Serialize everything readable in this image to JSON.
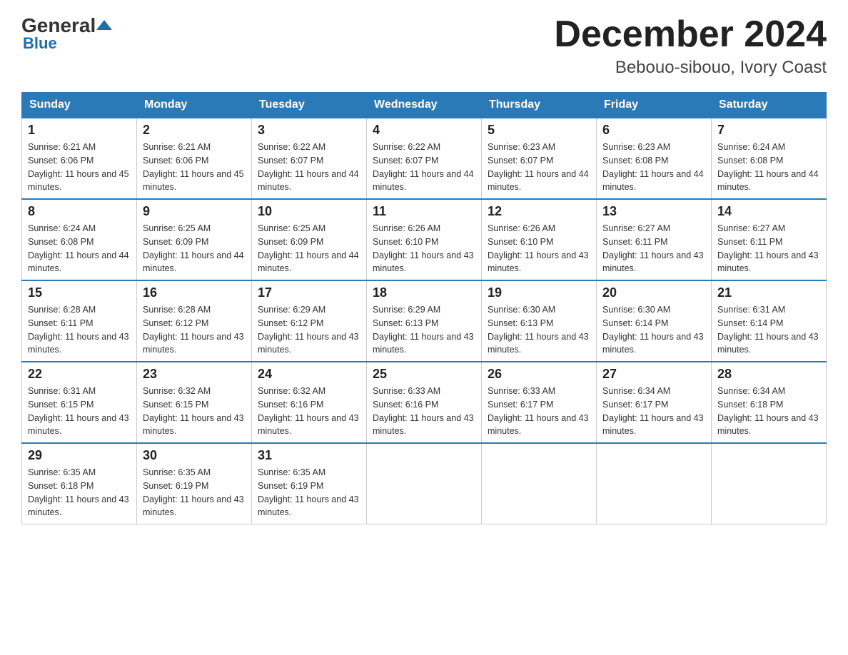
{
  "logo": {
    "name_black": "General",
    "name_blue": "Blue"
  },
  "title": "December 2024",
  "location": "Bebouo-sibouo, Ivory Coast",
  "days_of_week": [
    "Sunday",
    "Monday",
    "Tuesday",
    "Wednesday",
    "Thursday",
    "Friday",
    "Saturday"
  ],
  "weeks": [
    [
      {
        "num": "1",
        "sunrise": "6:21 AM",
        "sunset": "6:06 PM",
        "daylight": "11 hours and 45 minutes."
      },
      {
        "num": "2",
        "sunrise": "6:21 AM",
        "sunset": "6:06 PM",
        "daylight": "11 hours and 45 minutes."
      },
      {
        "num": "3",
        "sunrise": "6:22 AM",
        "sunset": "6:07 PM",
        "daylight": "11 hours and 44 minutes."
      },
      {
        "num": "4",
        "sunrise": "6:22 AM",
        "sunset": "6:07 PM",
        "daylight": "11 hours and 44 minutes."
      },
      {
        "num": "5",
        "sunrise": "6:23 AM",
        "sunset": "6:07 PM",
        "daylight": "11 hours and 44 minutes."
      },
      {
        "num": "6",
        "sunrise": "6:23 AM",
        "sunset": "6:08 PM",
        "daylight": "11 hours and 44 minutes."
      },
      {
        "num": "7",
        "sunrise": "6:24 AM",
        "sunset": "6:08 PM",
        "daylight": "11 hours and 44 minutes."
      }
    ],
    [
      {
        "num": "8",
        "sunrise": "6:24 AM",
        "sunset": "6:08 PM",
        "daylight": "11 hours and 44 minutes."
      },
      {
        "num": "9",
        "sunrise": "6:25 AM",
        "sunset": "6:09 PM",
        "daylight": "11 hours and 44 minutes."
      },
      {
        "num": "10",
        "sunrise": "6:25 AM",
        "sunset": "6:09 PM",
        "daylight": "11 hours and 44 minutes."
      },
      {
        "num": "11",
        "sunrise": "6:26 AM",
        "sunset": "6:10 PM",
        "daylight": "11 hours and 43 minutes."
      },
      {
        "num": "12",
        "sunrise": "6:26 AM",
        "sunset": "6:10 PM",
        "daylight": "11 hours and 43 minutes."
      },
      {
        "num": "13",
        "sunrise": "6:27 AM",
        "sunset": "6:11 PM",
        "daylight": "11 hours and 43 minutes."
      },
      {
        "num": "14",
        "sunrise": "6:27 AM",
        "sunset": "6:11 PM",
        "daylight": "11 hours and 43 minutes."
      }
    ],
    [
      {
        "num": "15",
        "sunrise": "6:28 AM",
        "sunset": "6:11 PM",
        "daylight": "11 hours and 43 minutes."
      },
      {
        "num": "16",
        "sunrise": "6:28 AM",
        "sunset": "6:12 PM",
        "daylight": "11 hours and 43 minutes."
      },
      {
        "num": "17",
        "sunrise": "6:29 AM",
        "sunset": "6:12 PM",
        "daylight": "11 hours and 43 minutes."
      },
      {
        "num": "18",
        "sunrise": "6:29 AM",
        "sunset": "6:13 PM",
        "daylight": "11 hours and 43 minutes."
      },
      {
        "num": "19",
        "sunrise": "6:30 AM",
        "sunset": "6:13 PM",
        "daylight": "11 hours and 43 minutes."
      },
      {
        "num": "20",
        "sunrise": "6:30 AM",
        "sunset": "6:14 PM",
        "daylight": "11 hours and 43 minutes."
      },
      {
        "num": "21",
        "sunrise": "6:31 AM",
        "sunset": "6:14 PM",
        "daylight": "11 hours and 43 minutes."
      }
    ],
    [
      {
        "num": "22",
        "sunrise": "6:31 AM",
        "sunset": "6:15 PM",
        "daylight": "11 hours and 43 minutes."
      },
      {
        "num": "23",
        "sunrise": "6:32 AM",
        "sunset": "6:15 PM",
        "daylight": "11 hours and 43 minutes."
      },
      {
        "num": "24",
        "sunrise": "6:32 AM",
        "sunset": "6:16 PM",
        "daylight": "11 hours and 43 minutes."
      },
      {
        "num": "25",
        "sunrise": "6:33 AM",
        "sunset": "6:16 PM",
        "daylight": "11 hours and 43 minutes."
      },
      {
        "num": "26",
        "sunrise": "6:33 AM",
        "sunset": "6:17 PM",
        "daylight": "11 hours and 43 minutes."
      },
      {
        "num": "27",
        "sunrise": "6:34 AM",
        "sunset": "6:17 PM",
        "daylight": "11 hours and 43 minutes."
      },
      {
        "num": "28",
        "sunrise": "6:34 AM",
        "sunset": "6:18 PM",
        "daylight": "11 hours and 43 minutes."
      }
    ],
    [
      {
        "num": "29",
        "sunrise": "6:35 AM",
        "sunset": "6:18 PM",
        "daylight": "11 hours and 43 minutes."
      },
      {
        "num": "30",
        "sunrise": "6:35 AM",
        "sunset": "6:19 PM",
        "daylight": "11 hours and 43 minutes."
      },
      {
        "num": "31",
        "sunrise": "6:35 AM",
        "sunset": "6:19 PM",
        "daylight": "11 hours and 43 minutes."
      },
      null,
      null,
      null,
      null
    ]
  ]
}
